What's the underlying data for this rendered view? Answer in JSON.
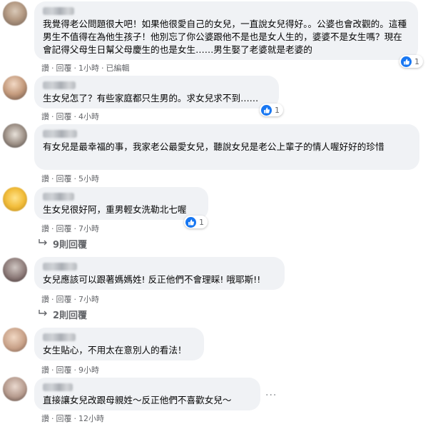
{
  "comments": [
    {
      "text": "我覺得老公問題很大吧！如果他很愛自己的女兒，一直說女兒得好。。公婆也會改觀的。這種男生不值得在為他生孩子！他別忘了你公婆跟他不是也是女人生的，婆婆不是女生嗎？現在會記得父母生日幫父母慶生的也是女生……男生娶了老婆就是老婆的",
      "like_label": "讚",
      "reply_label": "回覆",
      "time": "1小時",
      "edited": "已編輯",
      "reaction_count": "1"
    },
    {
      "text": "生女兒怎了？有些家庭都只生男的。求女兒求不到……",
      "like_label": "讚",
      "reply_label": "回覆",
      "time": "4小時",
      "reaction_count": "1"
    },
    {
      "text": "有女兒是最幸福的事，我家老公最愛女兒，聽說女兒是老公上輩子的情人喔好好的珍惜",
      "like_label": "讚",
      "reply_label": "回覆",
      "time": "5小時"
    },
    {
      "text": "生女兒很好阿，重男輕女洗勒北七喔",
      "like_label": "讚",
      "reply_label": "回覆",
      "time": "7小時",
      "reaction_count": "1",
      "replies_label": "9則回覆"
    },
    {
      "text": "女兒應該可以跟著媽媽姓! 反正他們不會理睬! 哦耶斯!!",
      "like_label": "讚",
      "reply_label": "回覆",
      "time": "7小時",
      "replies_label": "2則回覆"
    },
    {
      "text": "女生貼心，不用太在意別人的看法！",
      "like_label": "讚",
      "reply_label": "回覆",
      "time": "9小時"
    },
    {
      "text": "直接讓女兒改跟母親姓～反正他們不喜歡女兒～",
      "like_label": "讚",
      "reply_label": "回覆",
      "time": "12小時"
    }
  ],
  "icons": {
    "like": "thumbs-up-icon",
    "reply_arrow": "reply-arrow-icon",
    "more": "more-options-icon"
  },
  "colors": {
    "bubble": "#f0f2f5",
    "meta_text": "#65676b",
    "like_blue": "#1877f2"
  }
}
